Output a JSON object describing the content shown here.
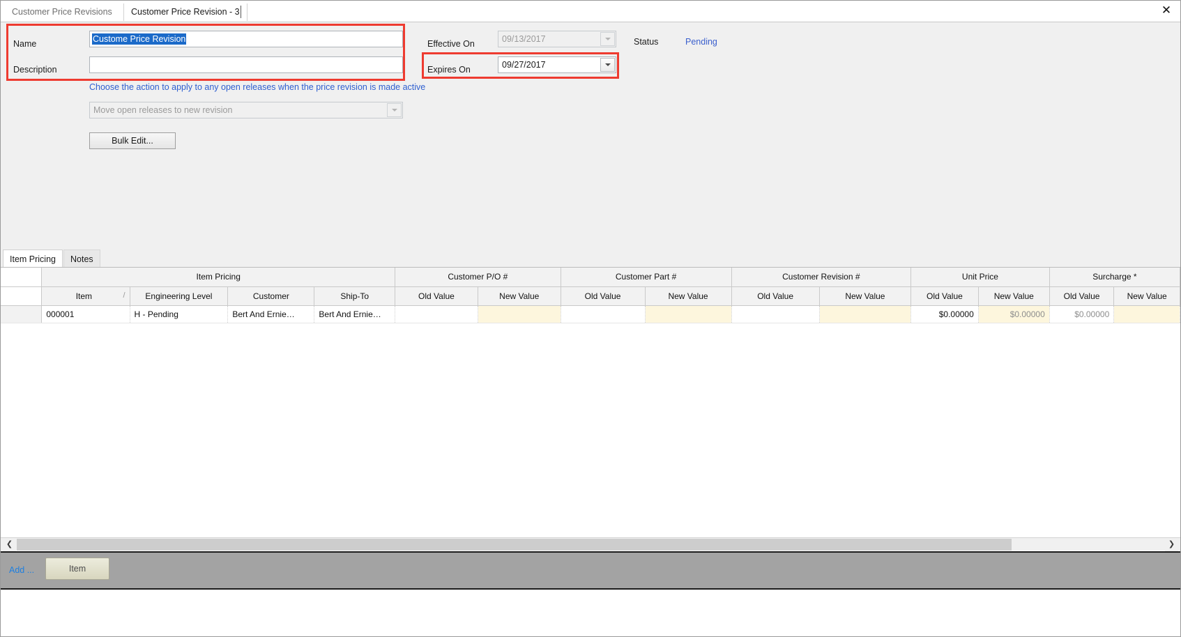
{
  "window": {
    "close_label": "✕"
  },
  "tabs": [
    {
      "label": "Customer Price Revisions",
      "active": false
    },
    {
      "label": "Customer Price Revision - 3",
      "active": true
    }
  ],
  "form": {
    "name_label": "Name",
    "name_value": "Custome Price Revision",
    "description_label": "Description",
    "description_value": "",
    "effective_on_label": "Effective On",
    "effective_on_value": "09/13/2017",
    "expires_on_label": "Expires On",
    "expires_on_value": "09/27/2017",
    "status_label": "Status",
    "status_value": "Pending",
    "hint": "Choose the action to apply to any open releases when the price revision is made active",
    "action_select_value": "Move open releases to new revision",
    "bulk_edit_label": "Bulk Edit..."
  },
  "lower_tabs": [
    {
      "label": "Item Pricing",
      "active": true
    },
    {
      "label": "Notes",
      "active": false
    }
  ],
  "grid": {
    "group_headers": [
      {
        "label": "",
        "span": 1
      },
      {
        "label": "Item Pricing",
        "span": 4
      },
      {
        "label": "Customer P/O #",
        "span": 2
      },
      {
        "label": "Customer Part #",
        "span": 2
      },
      {
        "label": "Customer Revision #",
        "span": 2
      },
      {
        "label": "Unit Price",
        "span": 2
      },
      {
        "label": "Surcharge *",
        "span": 2
      }
    ],
    "columns": [
      "",
      "Item",
      "Engineering Level",
      "Customer",
      "Ship-To",
      "Old Value",
      "New Value",
      "Old Value",
      "New Value",
      "Old Value",
      "New Value",
      "Old Value",
      "New Value",
      "Old Value",
      "New Value"
    ],
    "sort_indicator": "/",
    "rows": [
      {
        "item": "000001",
        "engineering_level": "H - Pending",
        "customer": "Bert And Ernie…",
        "ship_to": "Bert And Ernie…",
        "po_old": "",
        "po_new": "",
        "part_old": "",
        "part_new": "",
        "rev_old": "",
        "rev_new": "",
        "unit_price_old": "$0.00000",
        "unit_price_new": "$0.00000",
        "surcharge_old": "$0.00000",
        "surcharge_new": ""
      }
    ]
  },
  "scrollbar": {
    "left_arrow": "❮",
    "right_arrow": "❯"
  },
  "actionbar": {
    "add_label": "Add ...",
    "item_button_label": "Item"
  },
  "colors": {
    "highlight_red": "#ee3b30",
    "link_blue": "#2f5fd0",
    "selection_blue": "#1b6ac9",
    "editable_cell": "#fdf6dd",
    "actionbar_grey": "#a3a3a3"
  }
}
